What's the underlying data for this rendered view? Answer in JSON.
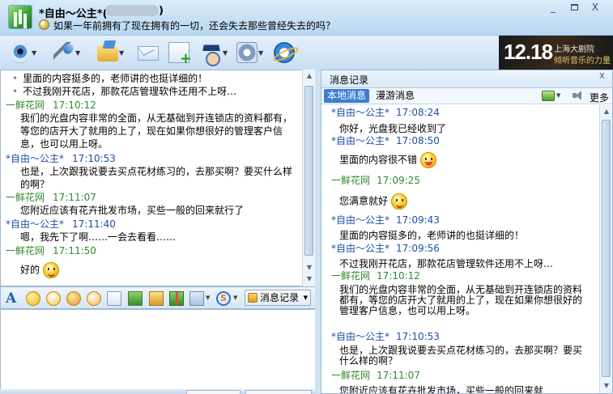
{
  "window": {
    "buddy_name": "*自由～公主*(",
    "buddy_id_suffix": ")",
    "signature": "如果一年前拥有了现在拥有的一切，还会失去那些曾经失去的吗？",
    "min_label": "_",
    "max_label": "",
    "close_label": "X"
  },
  "toolbar": {
    "icons": [
      "video-chat-icon",
      "voice-chat-icon",
      "send-file-icon",
      "send-email-icon",
      "apps-icon",
      "user-info-icon",
      "settings-icon",
      "browser-icon"
    ]
  },
  "ad": {
    "date": "12.18",
    "line1": "上海大剧院",
    "line2": "倾听音乐的力量"
  },
  "chat": {
    "bullets": [
      "里面的内容挺多的，老师讲的也挺详细的！",
      "不过我刚开花店，那款花店管理软件还用不上呀…"
    ],
    "messages": [
      {
        "sender": "一鲜花网",
        "time": "17:10:12",
        "text": "我们的光盘内容非常的全面，从无基础到开连锁店的资料都有，等您的店开大了就用的上了，现在如果你想很好的管理客户信息，也可以用上呀。"
      },
      {
        "sender": "*自由～公主*",
        "time": "17:10:53",
        "text": "也是，上次跟我说要去买点花材练习的，去那买啊？要买什么样的啊？"
      },
      {
        "sender": "一鲜花网",
        "time": "17:11:07",
        "text": "您附近应该有花卉批发市场，买些一般的回来就行了"
      },
      {
        "sender": "*自由～公主*",
        "time": "17:11:40",
        "text": "嗯，我先下了啊……一会去看看……"
      },
      {
        "sender": "一鲜花网",
        "time": "17:11:50",
        "text": "好的"
      }
    ]
  },
  "input_toolbar": {
    "font_label": "A",
    "s_label": "S",
    "history_button": "消息记录"
  },
  "history": {
    "title": "消息记录",
    "close": "X",
    "tabs": [
      "本地消息",
      "漫游消息"
    ],
    "more": "更多",
    "messages": [
      {
        "sender": "*自由～公主*",
        "time": "17:08:24",
        "text": "你好，光盘我已经收到了"
      },
      {
        "sender": "*自由～公主*",
        "time": "17:08:50",
        "text": "里面的内容很不错"
      },
      {
        "sender": "一鲜花网",
        "time": "17:09:25",
        "text": "您满意就好"
      },
      {
        "sender": "*自由～公主*",
        "time": "17:09:43",
        "text": "里面的内容挺多的，老师讲的也挺详细的！"
      },
      {
        "sender": "*自由～公主*",
        "time": "17:09:56",
        "text": "不过我刚开花店，那款花店管理软件还用不上呀…"
      },
      {
        "sender": "一鲜花网",
        "time": "17:10:12",
        "text": "我们的光盘内容非常的全面，从无基础到开连锁店的资料都有，等您的店开大了就用的上了，现在如果你想很好的管理客户信息，也可以用上呀。"
      },
      {
        "sender": "*自由～公主*",
        "time": "17:10:53",
        "text": "也是，上次跟我说要去买点花材练习的，去那买啊？要买什么样的啊？"
      },
      {
        "sender": "一鲜花网",
        "time": "17:11:07",
        "text": "您附近应该有花卉批发市场，买些一般的回来就"
      }
    ]
  },
  "colors": {
    "local_sender": "#2f8a2f",
    "remote_sender": "#1e4fa8",
    "active_tab": "#3b7dd1"
  }
}
